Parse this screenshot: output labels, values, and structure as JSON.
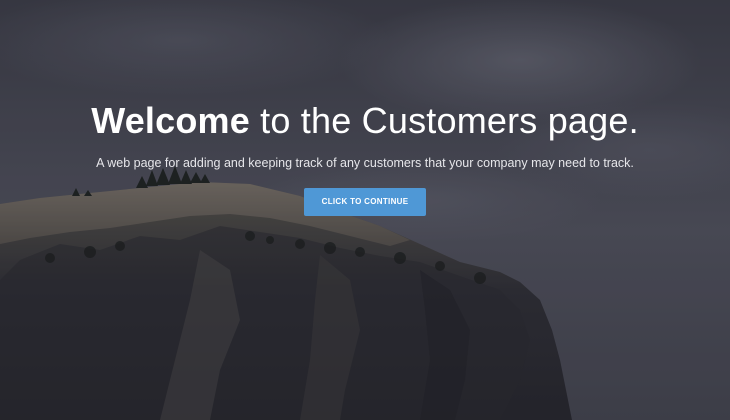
{
  "hero": {
    "headline_strong": "Welcome",
    "headline_rest": " to the Customers page.",
    "subtitle": "A web page for adding and keeping track of any customers that your company may need to track.",
    "cta_label": "CLICK TO CONTINUE"
  },
  "colors": {
    "button": "#4f98d6",
    "text": "#ffffff",
    "sky": "#4a4b56",
    "rock": "#2f2f36"
  },
  "background_image": "cloudy-sky-with-rocky-cliff"
}
